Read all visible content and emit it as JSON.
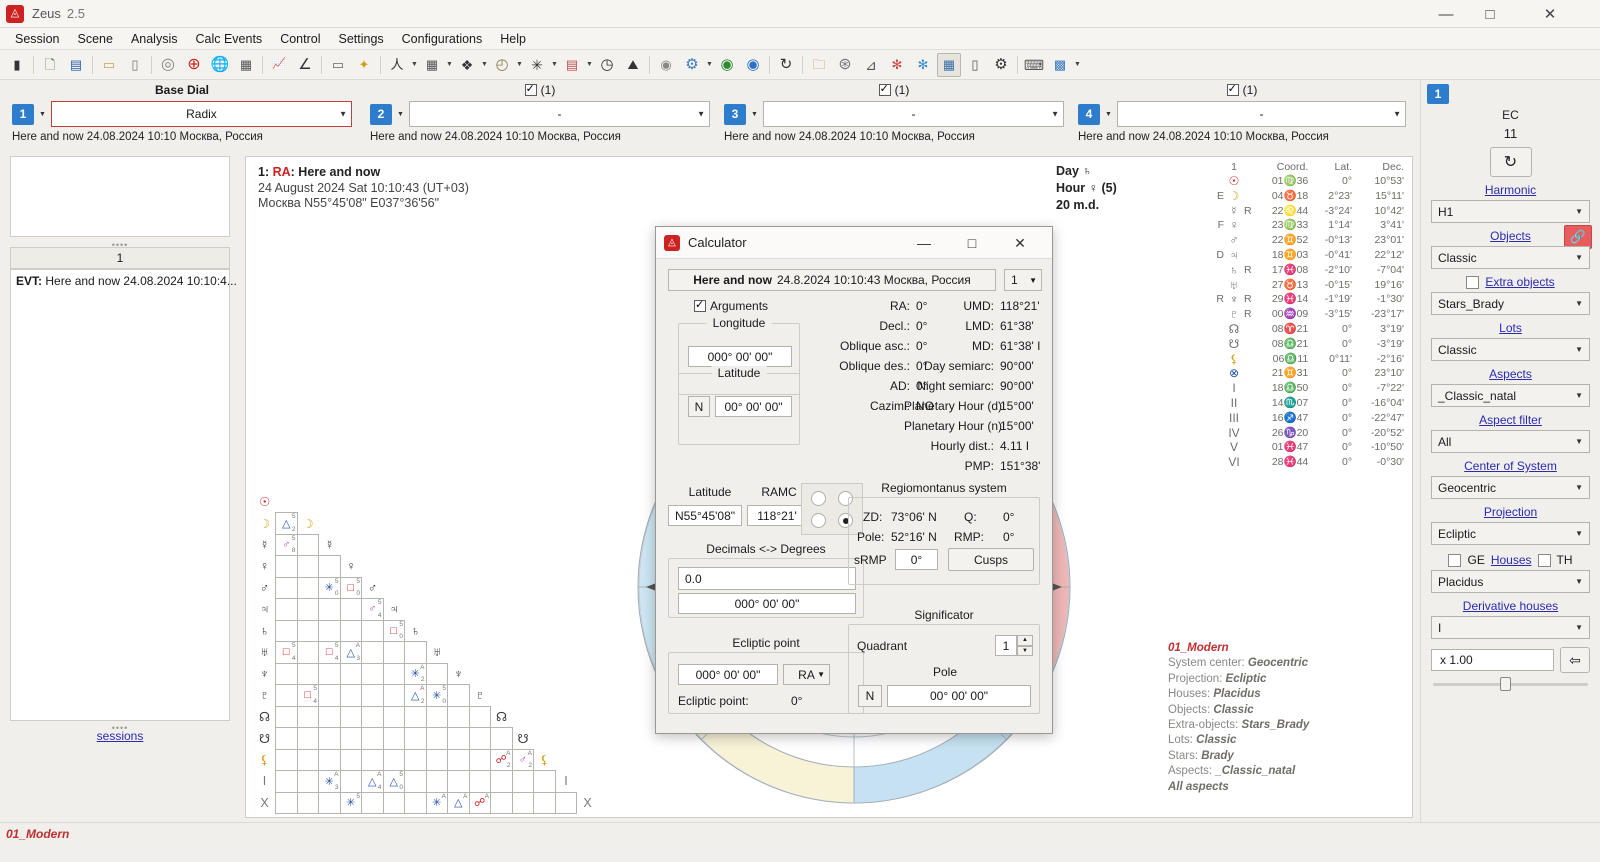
{
  "window": {
    "app_name": "Zeus",
    "version": "2.5",
    "minimize": "—",
    "maximize": "□",
    "close": "✕"
  },
  "menu": [
    "Session",
    "Scene",
    "Analysis",
    "Calc Events",
    "Control",
    "Settings",
    "Configurations",
    "Help"
  ],
  "toolbar": {
    "icons": [
      {
        "name": "database-icon",
        "glyph": "▮"
      },
      {
        "name": "new-document-icon",
        "glyph": "🗋"
      },
      {
        "name": "save-icon",
        "glyph": "▤"
      },
      {
        "name": "briefcase-icon",
        "glyph": "▭"
      },
      {
        "name": "book-icon",
        "glyph": "▯"
      },
      {
        "name": "target-icon",
        "glyph": "◎"
      },
      {
        "name": "red-globe-icon",
        "glyph": "⊕"
      },
      {
        "name": "blue-globe-icon",
        "glyph": "🌐"
      },
      {
        "name": "calculator-icon",
        "glyph": "▦"
      },
      {
        "name": "chart-line-icon",
        "glyph": "📈"
      },
      {
        "name": "angle-icon",
        "glyph": "∠"
      },
      {
        "name": "ruler-icon",
        "glyph": "▭"
      },
      {
        "name": "sparkle-icon",
        "glyph": "✦"
      },
      {
        "name": "person-icon",
        "glyph": "人"
      },
      {
        "name": "grid-icon",
        "glyph": "▦"
      },
      {
        "name": "clover-icon",
        "glyph": "❖"
      },
      {
        "name": "clock-dial-icon",
        "glyph": "◴"
      },
      {
        "name": "asterisk-icon",
        "glyph": "✳"
      },
      {
        "name": "calendar-icon",
        "glyph": "▤"
      },
      {
        "name": "stopwatch-icon",
        "glyph": "◷"
      },
      {
        "name": "mountain-icon",
        "glyph": "⛰"
      },
      {
        "name": "eye-icon",
        "glyph": "◉"
      },
      {
        "name": "gear-blue-icon",
        "glyph": "⚙"
      },
      {
        "name": "record-green-icon",
        "glyph": "◉"
      },
      {
        "name": "record-blue-icon",
        "glyph": "◉"
      },
      {
        "name": "refresh-icon",
        "glyph": "↻"
      },
      {
        "name": "open-folder-icon",
        "glyph": "🗀"
      },
      {
        "name": "wheel-icon",
        "glyph": "⊛"
      },
      {
        "name": "flag-icon",
        "glyph": "⊿"
      },
      {
        "name": "red-sphere-gear-icon",
        "glyph": "✻"
      },
      {
        "name": "blue-sphere-gear-icon",
        "glyph": "✻"
      },
      {
        "name": "table-icon",
        "glyph": "▦"
      },
      {
        "name": "battery-icon",
        "glyph": "▯"
      },
      {
        "name": "settings-gear-icon",
        "glyph": "⚙"
      },
      {
        "name": "keyboard-icon",
        "glyph": "⌨"
      },
      {
        "name": "image-gear-icon",
        "glyph": "▩"
      }
    ]
  },
  "dials": [
    {
      "number": "1",
      "header": "Base Dial",
      "header_checked": false,
      "value": "Radix",
      "subtitle": "Here and now 24.08.2024 10:10 Москва, Россия",
      "active": true
    },
    {
      "number": "2",
      "header": "(1)",
      "header_checked": true,
      "value": "-",
      "subtitle": "Here and now 24.08.2024 10:10 Москва, Россия",
      "active": false
    },
    {
      "number": "3",
      "header": "(1)",
      "header_checked": true,
      "value": "-",
      "subtitle": "Here and now 24.08.2024 10:10 Москва, Россия",
      "active": false
    },
    {
      "number": "4",
      "header": "(1)",
      "header_checked": true,
      "value": "-",
      "subtitle": "Here and now 24.08.2024 10:10 Москва, Россия",
      "active": false
    }
  ],
  "left_panel": {
    "list_header": "1",
    "event_prefix": "EVT:",
    "event_text": "Here and now 24.08.2024 10:10:4...",
    "sessions_link": "sessions",
    "grip": "••••"
  },
  "chart_header": {
    "line1_num": "1: ",
    "line1_ra": "RA",
    "line1_rest": ": Here and now",
    "line2": "24 August 2024 Sat 10:10:43 (UT+03)",
    "line3": "Москва N55°45'08\" E037°36'56\""
  },
  "day_hour": {
    "day": "Day ♄",
    "hour": "Hour ♀ (5)",
    "md": "20 m.d."
  },
  "ephemeris": {
    "headers": {
      "num": "1",
      "coord": "Coord.",
      "lat": "Lat.",
      "dec": "Dec."
    },
    "rows": [
      {
        "pre": "",
        "glyph": "☉",
        "cls": "g-sun",
        "retro": "",
        "coord": "01♍36",
        "lat": "0°",
        "dec": "10°53'"
      },
      {
        "pre": "E",
        "glyph": "☽",
        "cls": "g-moon",
        "retro": "",
        "coord": "04♉18",
        "lat": "2°23'",
        "dec": "15°11'"
      },
      {
        "pre": "",
        "glyph": "☿",
        "cls": "g-merc",
        "retro": "R",
        "coord": "22♌44",
        "lat": "-3°24'",
        "dec": "10°42'"
      },
      {
        "pre": "F",
        "glyph": "♀",
        "cls": "g-ven",
        "retro": "",
        "coord": "23♍33",
        "lat": "1°14'",
        "dec": "3°41'"
      },
      {
        "pre": "",
        "glyph": "♂",
        "cls": "g-mars",
        "retro": "",
        "coord": "22♊52",
        "lat": "-0°13'",
        "dec": "23°01'"
      },
      {
        "pre": "D",
        "glyph": "♃",
        "cls": "g-jup",
        "retro": "",
        "coord": "18♊03",
        "lat": "-0°41'",
        "dec": "22°12'"
      },
      {
        "pre": "",
        "glyph": "♄",
        "cls": "g-sat",
        "retro": "R",
        "coord": "17♓08",
        "lat": "-2°10'",
        "dec": "-7°04'"
      },
      {
        "pre": "",
        "glyph": "♅",
        "cls": "g-ura",
        "retro": "",
        "coord": "27♉13",
        "lat": "-0°15'",
        "dec": "19°16'"
      },
      {
        "pre": "R",
        "glyph": "♆",
        "cls": "g-nep",
        "retro": "R",
        "coord": "29♓14",
        "lat": "-1°19'",
        "dec": "-1°30'"
      },
      {
        "pre": "",
        "glyph": "♇",
        "cls": "g-plu",
        "retro": "R",
        "coord": "00♒09",
        "lat": "-3°15'",
        "dec": "-23°17'"
      },
      {
        "pre": "",
        "glyph": "☊",
        "cls": "g-rom",
        "retro": "",
        "coord": "08♈21",
        "lat": "0°",
        "dec": "3°19'"
      },
      {
        "pre": "",
        "glyph": "☋",
        "cls": "g-rom",
        "retro": "",
        "coord": "08♎21",
        "lat": "0°",
        "dec": "-3°19'"
      },
      {
        "pre": "",
        "glyph": "⚸",
        "cls": "g-lot",
        "retro": "",
        "coord": "06♎11",
        "lat": "0°11'",
        "dec": "-2°16'"
      },
      {
        "pre": "",
        "glyph": "⊗",
        "cls": "g-pof",
        "retro": "",
        "coord": "21♊31",
        "lat": "0°",
        "dec": "23°10'"
      },
      {
        "pre": "",
        "glyph": "I",
        "cls": "g-rom",
        "retro": "",
        "coord": "18♎50",
        "lat": "0°",
        "dec": "-7°22'"
      },
      {
        "pre": "",
        "glyph": "II",
        "cls": "g-rom",
        "retro": "",
        "coord": "14♏07",
        "lat": "0°",
        "dec": "-16°04'"
      },
      {
        "pre": "",
        "glyph": "III",
        "cls": "g-rom",
        "retro": "",
        "coord": "16♐47",
        "lat": "0°",
        "dec": "-22°47'"
      },
      {
        "pre": "",
        "glyph": "IV",
        "cls": "g-rom",
        "retro": "",
        "coord": "26♑20",
        "lat": "0°",
        "dec": "-20°52'"
      },
      {
        "pre": "",
        "glyph": "V",
        "cls": "g-rom",
        "retro": "",
        "coord": "01♓47",
        "lat": "0°",
        "dec": "-10°50'"
      },
      {
        "pre": "",
        "glyph": "VI",
        "cls": "g-rom",
        "retro": "",
        "coord": "28♓44",
        "lat": "0°",
        "dec": "-0°30'"
      }
    ]
  },
  "chart_settings": {
    "title": "01_Modern",
    "lines": [
      {
        "label": "System center: ",
        "value": "Geocentric"
      },
      {
        "label": "Projection: ",
        "value": "Ecliptic"
      },
      {
        "label": "Houses: ",
        "value": "Placidus"
      },
      {
        "label": "Objects: ",
        "value": "Classic"
      },
      {
        "label": "Extra-objects: ",
        "value": "Stars_Brady"
      },
      {
        "label": "Lots: ",
        "value": "Classic"
      },
      {
        "label": "Stars: ",
        "value": "Brady"
      },
      {
        "label": "Aspects: ",
        "value": "_Classic_natal"
      }
    ],
    "footer": "All aspects"
  },
  "right_sidebar": {
    "badge": "1",
    "ec_label": "EC",
    "harmonic_number": "11",
    "refresh_icon": "↻",
    "harmonic_label": "Harmonic",
    "harmonic_value": "H1",
    "objects_label": "Objects",
    "objects_value": "Classic",
    "link_icon": "🔗",
    "extra_objects_label": "Extra objects",
    "extra_objects_value": "Stars_Brady",
    "lots_label": "Lots",
    "lots_value": "Classic",
    "aspects_label": "Aspects",
    "aspects_value": "_Classic_natal",
    "aspect_filter_label": "Aspect filter",
    "aspect_filter_value": "All",
    "center_label": "Center of System",
    "center_value": "Geocentric",
    "projection_label": "Projection",
    "projection_value": "Ecliptic",
    "ge_label": "GE",
    "houses_label": "Houses",
    "th_label": "TH",
    "houses_value": "Placidus",
    "derivative_label": "Derivative houses",
    "derivative_value": "I",
    "scale_value": "x 1.00",
    "undo_icon": "⇦"
  },
  "status_bar": {
    "text": "01_Modern"
  },
  "calculator": {
    "title": "Calculator",
    "minimize": "—",
    "maximize": "□",
    "close": "✕",
    "header_bold": "Here and now",
    "header_rest": "24.8.2024 10:10:43 Москва, Россия",
    "header_select": "1",
    "arguments_label": "Arguments",
    "arguments_checked": true,
    "longitude_label": "Longitude",
    "longitude_value": "000° 00' 00\"",
    "latitude_label": "Latitude",
    "latitude_ns": "N",
    "latitude_value": "00° 00' 00\"",
    "readout_left": [
      {
        "key": "RA:",
        "value": "0°"
      },
      {
        "key": "Decl.:",
        "value": "0°"
      },
      {
        "key": "Oblique asc.:",
        "value": "0°"
      },
      {
        "key": "Oblique des.:",
        "value": "0°"
      },
      {
        "key": "AD:",
        "value": "0°"
      },
      {
        "key": "Cazimi:",
        "value": "NO"
      }
    ],
    "readout_right": [
      {
        "key": "UMD:",
        "value": "118°21'"
      },
      {
        "key": "LMD:",
        "value": "61°38'"
      },
      {
        "key": "MD:",
        "value": "61°38' I"
      },
      {
        "key": "Day semiarc:",
        "value": "90°00'"
      },
      {
        "key": "Night semiarc:",
        "value": "90°00'"
      },
      {
        "key": "Planetary  Hour (d):",
        "value": "15°00'"
      },
      {
        "key": "Planetary  Hour (n):",
        "value": "15°00'"
      },
      {
        "key": "Hourly dist.:",
        "value": "4.11 I"
      },
      {
        "key": "PMP:",
        "value": "151°38'"
      }
    ],
    "latitude2_label": "Latitude",
    "latitude2_value": "N55°45'08\"",
    "ramc_label": "RAMC",
    "ramc_value": "118°21'",
    "radio_selected_index": 3,
    "decimals_label": "Decimals <-> Degrees",
    "decimals_value": "0.0",
    "degrees_value": "000° 00' 00\"",
    "ecliptic_point_label": "Ecliptic point",
    "ecliptic_point_value": "000° 00' 00\"",
    "ecliptic_point_mode": "RA",
    "ecliptic_point_result_label": "Ecliptic point:",
    "ecliptic_point_result": "0°",
    "regiomontanus_label": "Regiomontanus system",
    "zd_label": "ZD:",
    "zd_value": "73°06' N",
    "q_label": "Q:",
    "q_value": "0°",
    "pole_label": "Pole:",
    "pole_value": "52°16' N",
    "rmp_label": "RMP:",
    "rmp_value": "0°",
    "srmp_label": "sRMP",
    "srmp_value": "0°",
    "cusps_button": "Cusps",
    "significator_label": "Significator",
    "quadrant_label": "Quadrant",
    "quadrant_value": "1",
    "sig_pole_label": "Pole",
    "sig_pole_ns": "N",
    "sig_pole_value": "00° 00' 00\""
  },
  "aspect_grid": {
    "objects": [
      "☉",
      "☽",
      "☿",
      "♀",
      "♂",
      "♃",
      "♄",
      "♅",
      "♆",
      "♇",
      "☊",
      "☋",
      "⚸",
      "I",
      "X"
    ],
    "aspects": [
      {
        "row": 1,
        "col": 0,
        "glyph": "△",
        "cls": "a-tri",
        "top": "5",
        "bot": "2"
      },
      {
        "row": 2,
        "col": 0,
        "glyph": "♂",
        "cls": "a-con",
        "top": "5",
        "bot": "8"
      },
      {
        "row": 4,
        "col": 2,
        "glyph": "✳",
        "cls": "a-sex",
        "top": "5",
        "bot": "0"
      },
      {
        "row": 4,
        "col": 3,
        "glyph": "□",
        "cls": "a-sq",
        "top": "5",
        "bot": "0"
      },
      {
        "row": 5,
        "col": 4,
        "glyph": "♂",
        "cls": "a-con",
        "top": "5",
        "bot": "4"
      },
      {
        "row": 6,
        "col": 5,
        "glyph": "□",
        "cls": "a-sq",
        "top": "5",
        "bot": "0"
      },
      {
        "row": 7,
        "col": 0,
        "glyph": "□",
        "cls": "a-sq",
        "top": "5",
        "bot": "4"
      },
      {
        "row": 7,
        "col": 2,
        "glyph": "□",
        "cls": "a-sq",
        "top": "5",
        "bot": "4"
      },
      {
        "row": 7,
        "col": 3,
        "glyph": "△",
        "cls": "a-tri",
        "top": "A",
        "bot": "3"
      },
      {
        "row": 8,
        "col": 6,
        "glyph": "✳",
        "cls": "a-sex",
        "top": "A",
        "bot": "2"
      },
      {
        "row": 9,
        "col": 1,
        "glyph": "□",
        "cls": "a-sq",
        "top": "5",
        "bot": "4"
      },
      {
        "row": 9,
        "col": 6,
        "glyph": "△",
        "cls": "a-tri",
        "top": "A",
        "bot": "2"
      },
      {
        "row": 9,
        "col": 7,
        "glyph": "✳",
        "cls": "a-sex",
        "top": "5",
        "bot": "0"
      },
      {
        "row": 12,
        "col": 10,
        "glyph": "☍",
        "cls": "a-opp",
        "top": "A",
        "bot": "2"
      },
      {
        "row": 12,
        "col": 11,
        "glyph": "♂",
        "cls": "a-con",
        "top": "A",
        "bot": "2"
      },
      {
        "row": 13,
        "col": 2,
        "glyph": "✳",
        "cls": "a-sex",
        "top": "A",
        "bot": "3"
      },
      {
        "row": 13,
        "col": 4,
        "glyph": "△",
        "cls": "a-tri",
        "top": "A",
        "bot": "4"
      },
      {
        "row": 13,
        "col": 5,
        "glyph": "△",
        "cls": "a-tri",
        "top": "5",
        "bot": "0"
      },
      {
        "row": 14,
        "col": 3,
        "glyph": "✳",
        "cls": "a-sex",
        "top": "5",
        "bot": ""
      },
      {
        "row": 14,
        "col": 7,
        "glyph": "✳",
        "cls": "a-sex",
        "top": "A",
        "bot": ""
      },
      {
        "row": 14,
        "col": 8,
        "glyph": "△",
        "cls": "a-tri",
        "top": "A",
        "bot": ""
      },
      {
        "row": 14,
        "col": 9,
        "glyph": "☍",
        "cls": "a-opp",
        "top": "A",
        "bot": ""
      }
    ]
  }
}
